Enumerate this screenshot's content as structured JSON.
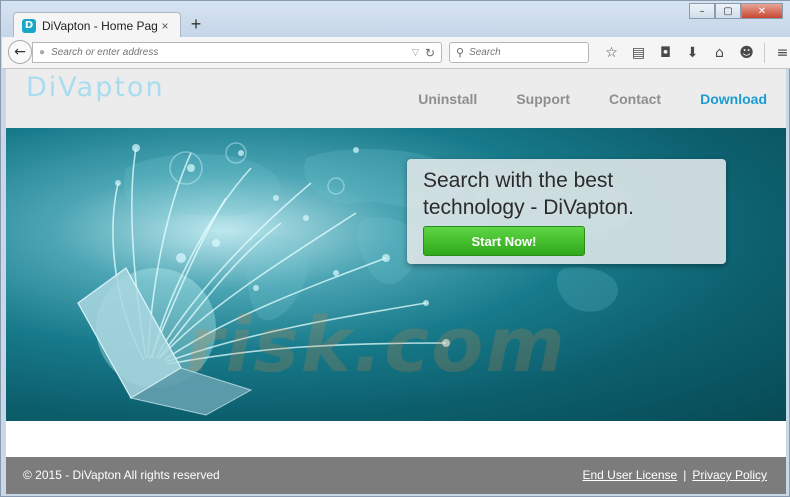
{
  "browser": {
    "tab": {
      "favicon": "D",
      "title": "DiVapton - Home Page",
      "close": "×"
    },
    "new_tab": "+",
    "window_controls": [
      "–",
      "▢",
      "✕"
    ],
    "url_placeholder": "Search or enter address",
    "search_placeholder": "Search",
    "toolbar_icons": [
      "star-icon",
      "reading-list-icon",
      "pocket-icon",
      "download-icon",
      "home-icon",
      "chat-icon",
      "menu-icon"
    ]
  },
  "site": {
    "logo": "DiVapton",
    "nav": [
      "Uninstall",
      "Support",
      "Contact",
      "Download"
    ],
    "active_nav": "Download",
    "hero_text": "Search with the best technology - DiVapton.",
    "start_button": "Start Now!",
    "watermark": "risk.com",
    "footer": {
      "copyright": "© 2015 - DiVapton All rights reserved",
      "links": [
        "End User License",
        "Privacy Policy"
      ],
      "separator": "|"
    }
  },
  "colors": {
    "accent": "#1c9bd0",
    "button_green": "#3dbf27",
    "hero_dark": "#0c5e6c",
    "footer_bg": "#7c7c7c"
  }
}
